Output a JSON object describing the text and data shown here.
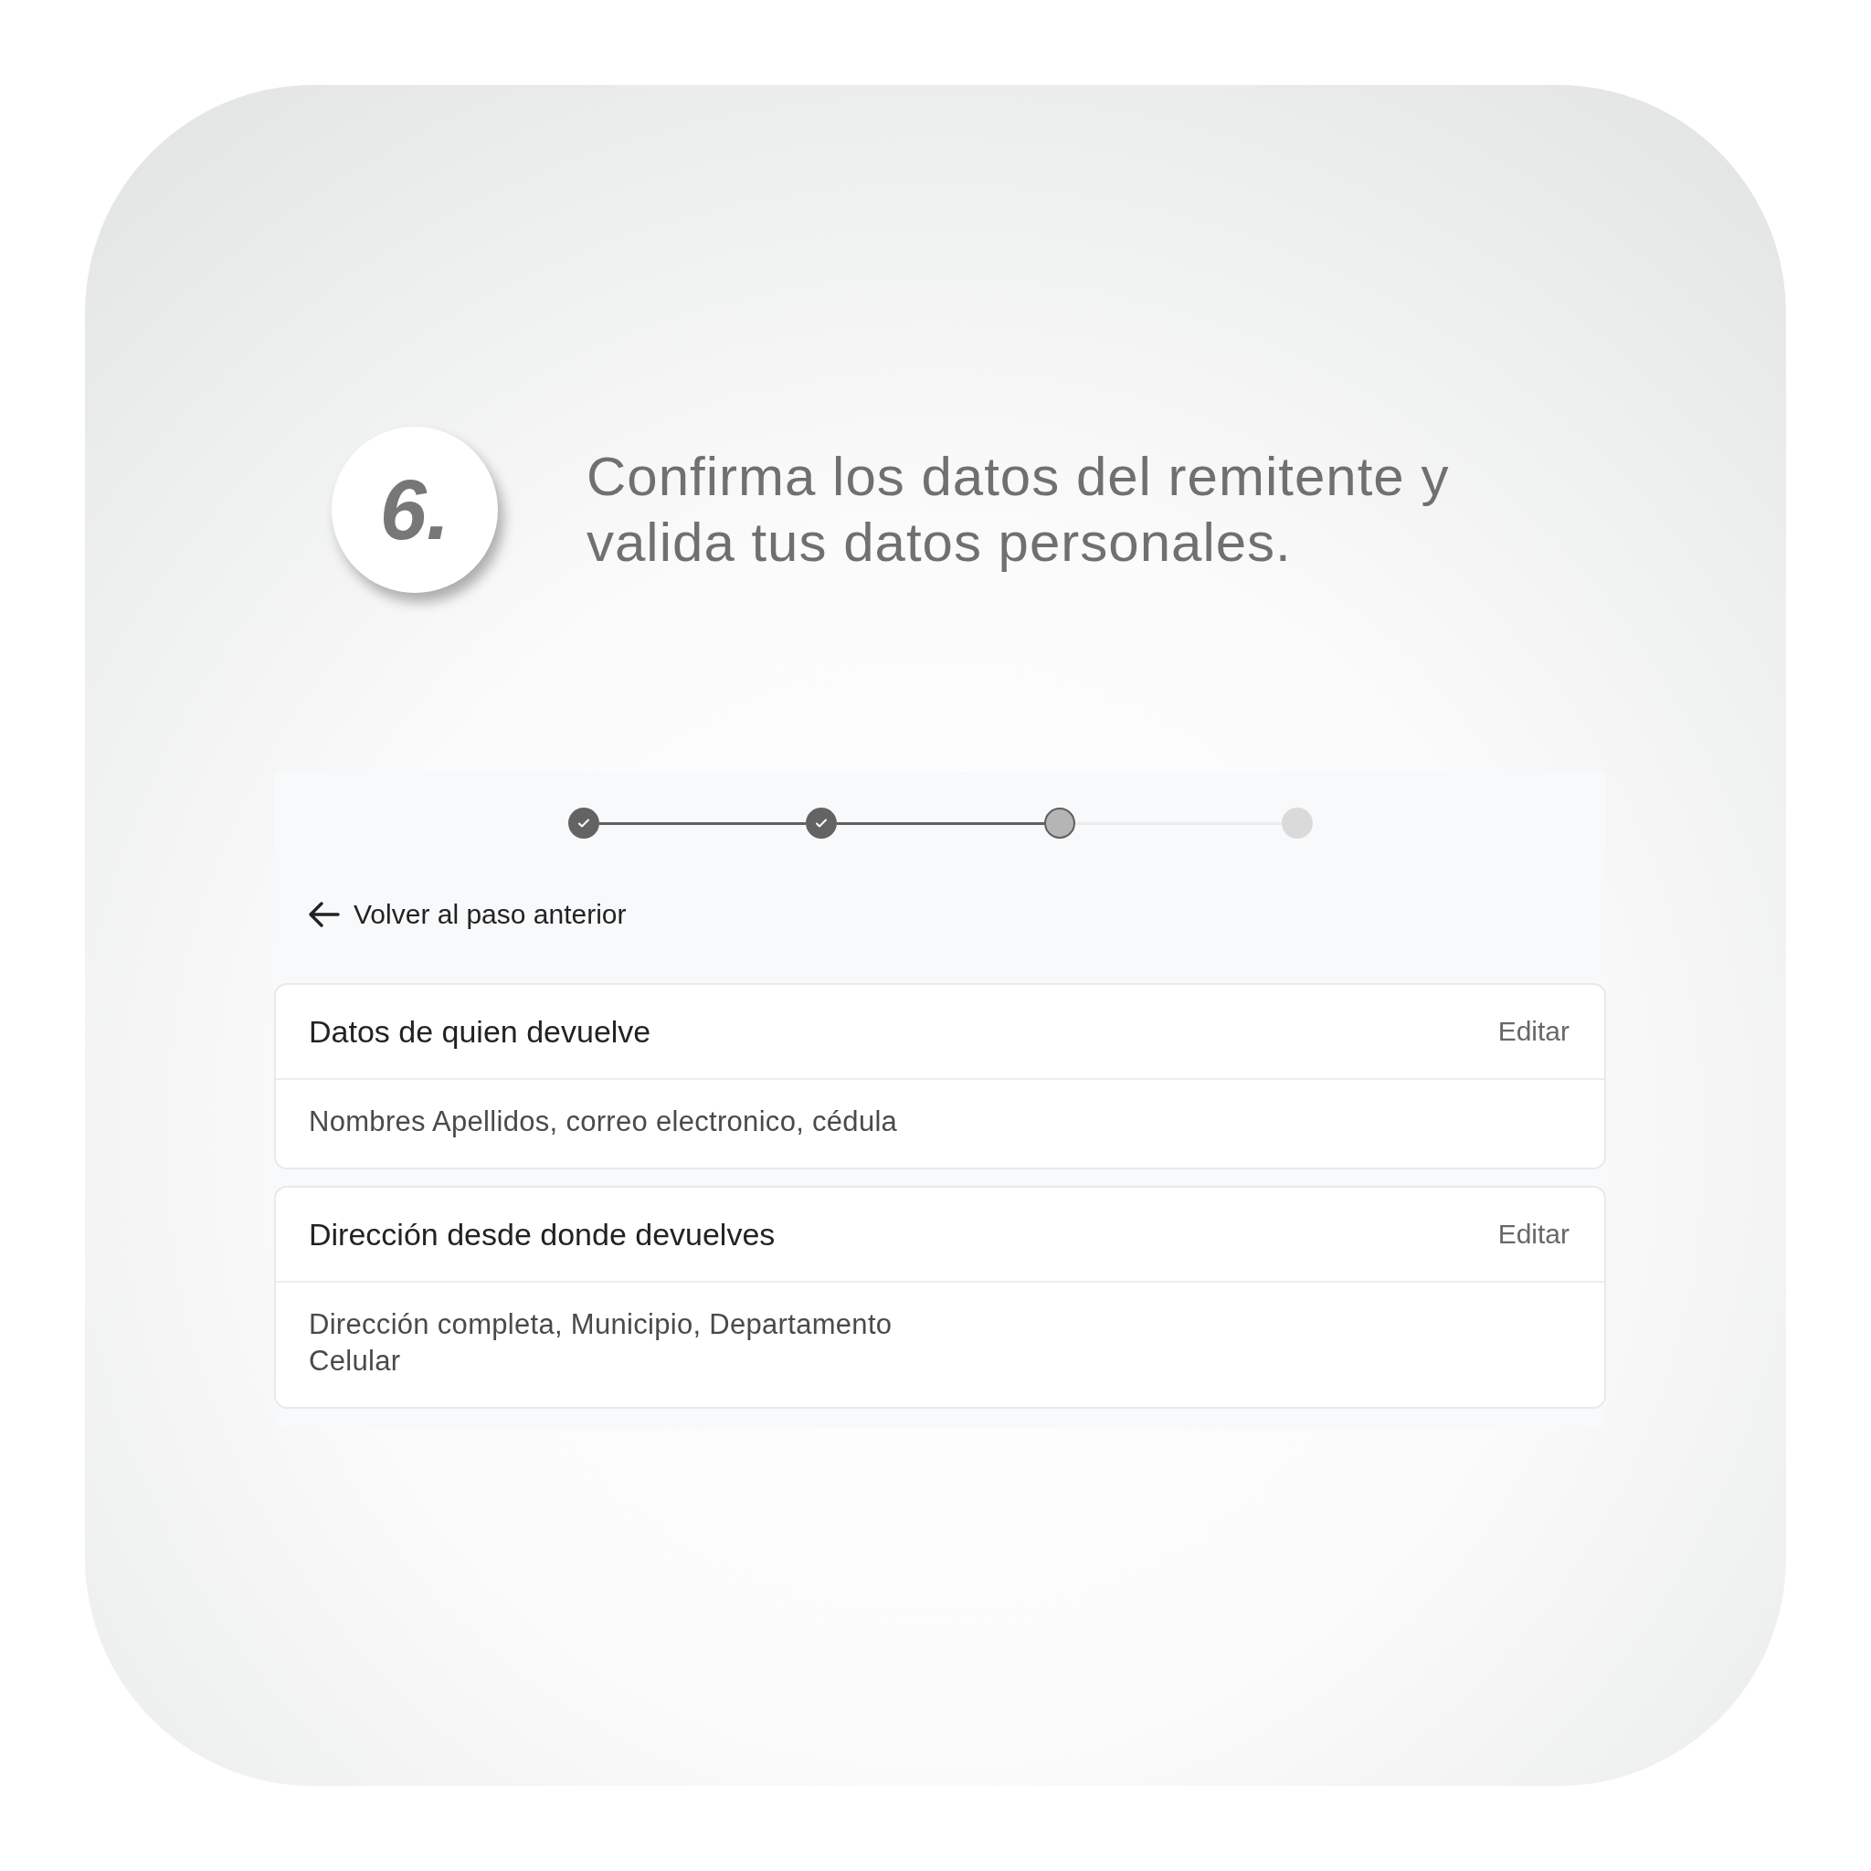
{
  "step_badge": "6.",
  "instruction": "Confirma los datos del remitente y valida tus datos personales.",
  "stepper": [
    {
      "completed": true,
      "selected": false
    },
    {
      "completed": true,
      "selected": false
    },
    {
      "completed": false,
      "selected": true
    },
    {
      "completed": false,
      "selected": false
    }
  ],
  "back_link": "Volver al paso anterior",
  "sections": [
    {
      "title": "Datos de quien devuelve",
      "action": "Editar",
      "lines": [
        "Nombres Apellidos, correo electronico, cédula"
      ]
    },
    {
      "title": "Dirección desde donde devuelves",
      "action": "Editar",
      "lines": [
        "Dirección completa, Municipio, Departamento",
        "Celular"
      ]
    }
  ]
}
